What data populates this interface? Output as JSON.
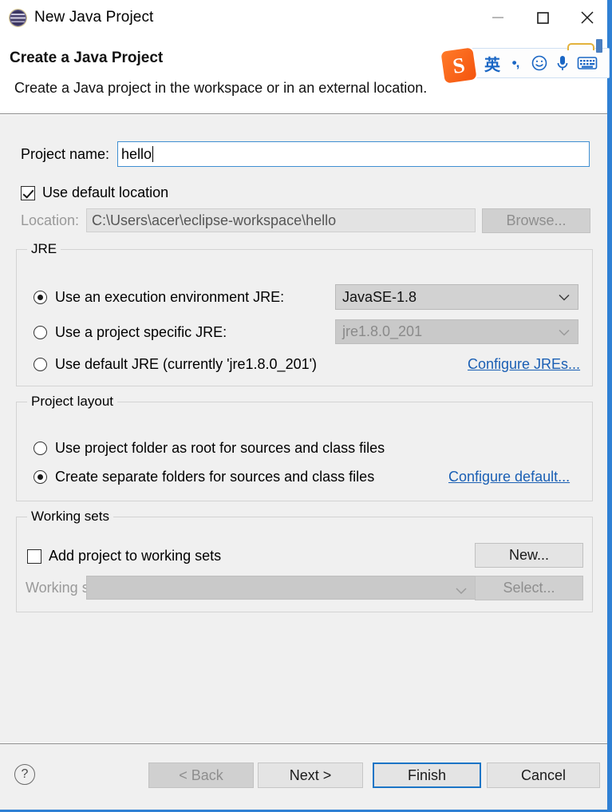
{
  "window": {
    "title": "New Java Project",
    "icon": "eclipse-globe-icon",
    "controls": {
      "minimize": "minimize-icon",
      "maximize": "maximize-icon",
      "close": "close-icon"
    },
    "border_color": "#2f80d4"
  },
  "header": {
    "title": "Create a Java Project",
    "description": "Create a Java project in the workspace or in an external location."
  },
  "ime_toolbar": {
    "logo": "S",
    "language_mode": "英",
    "punctuation": "•,",
    "emoji": "☺",
    "voice": "microphone-icon",
    "keyboard": "keyboard-icon"
  },
  "project_name": {
    "label": "Project name:",
    "value": "hello",
    "placeholder": ""
  },
  "location": {
    "use_default_label": "Use default location",
    "use_default_checked": true,
    "label": "Location:",
    "value": "C:\\Users\\acer\\eclipse-workspace\\hello",
    "browse_label": "Browse..."
  },
  "jre": {
    "legend": "JRE",
    "options": [
      {
        "label": "Use an execution environment JRE:",
        "selected": true
      },
      {
        "label": "Use a project specific JRE:",
        "selected": false
      },
      {
        "label": "Use default JRE (currently 'jre1.8.0_201')",
        "selected": false
      }
    ],
    "execution_environment_value": "JavaSE-1.8",
    "project_specific_value": "jre1.8.0_201",
    "configure_link": "Configure JREs..."
  },
  "project_layout": {
    "legend": "Project layout",
    "options": [
      {
        "label": "Use project folder as root for sources and class files",
        "selected": false
      },
      {
        "label": "Create separate folders for sources and class files",
        "selected": true
      }
    ],
    "configure_link": "Configure default..."
  },
  "working_sets": {
    "legend": "Working sets",
    "add_label": "Add project to working sets",
    "add_checked": false,
    "new_label": "New...",
    "sets_label": "Working sets:",
    "sets_value": "",
    "select_label": "Select..."
  },
  "footer": {
    "help": "?",
    "back": "< Back",
    "next": "Next >",
    "finish": "Finish",
    "cancel": "Cancel"
  }
}
